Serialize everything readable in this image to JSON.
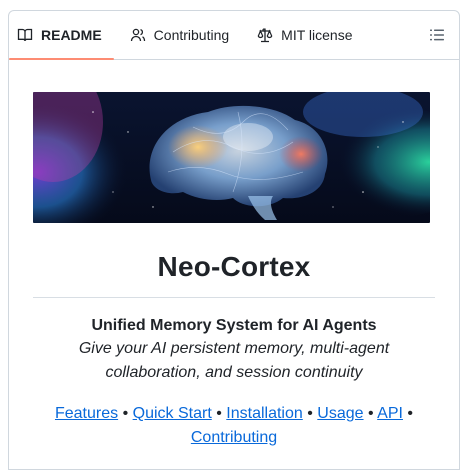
{
  "tabs": [
    {
      "label": "README",
      "icon": "book-icon",
      "active": true
    },
    {
      "label": "Contributing",
      "icon": "people-icon",
      "active": false
    },
    {
      "label": "MIT license",
      "icon": "law-scale-icon",
      "active": false
    }
  ],
  "outline_icon": "list-unordered-icon",
  "readme": {
    "title": "Neo-Cortex",
    "subtitle": "Unified Memory System for AI Agents",
    "tagline": "Give your AI persistent memory, multi-agent collaboration, and session continuity",
    "separator": "•",
    "links": [
      "Features",
      "Quick Start",
      "Installation",
      "Usage",
      "API",
      "Contributing"
    ]
  },
  "colors": {
    "link": "#0969da",
    "active_tab_underline": "#fd8c73",
    "border": "#d0d7de"
  }
}
